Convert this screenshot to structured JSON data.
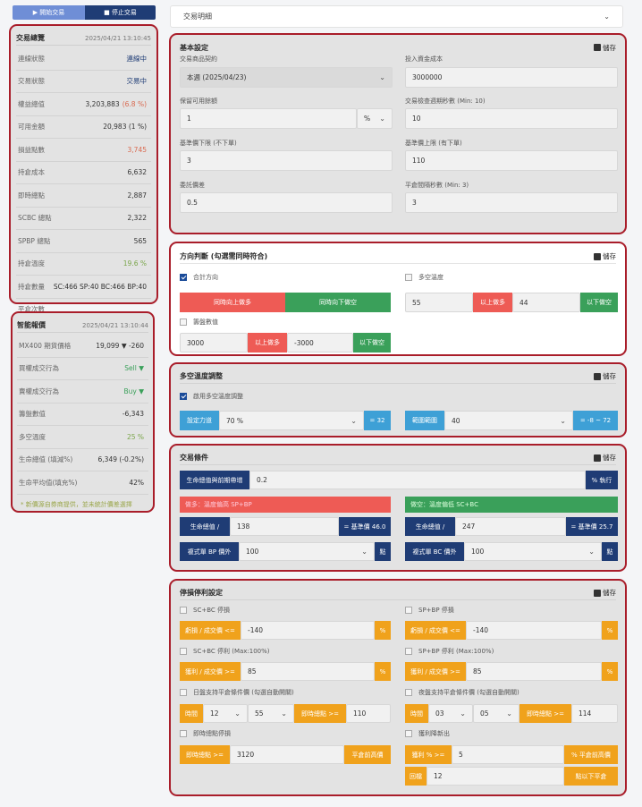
{
  "top_buttons": {
    "start": "▶ 開始交易",
    "stop": "■ 停止交易"
  },
  "overview": {
    "title": "交易總覽",
    "time": "2025/04/21 13:10:45",
    "rows": [
      {
        "label": "連線狀態",
        "value": "連線中"
      },
      {
        "label": "交易狀態",
        "value": "交易中"
      },
      {
        "label": "權益總值",
        "value": "3,203,883",
        "extra": "(6.8 %)"
      },
      {
        "label": "可用金額",
        "value": "20,983 (1 %)"
      },
      {
        "label": "損益點數",
        "value": "3,745"
      },
      {
        "label": "持倉成本",
        "value": "6,632"
      },
      {
        "label": "即時總點",
        "value": "2,887"
      },
      {
        "label": "SCBC 總點",
        "value": "2,322"
      },
      {
        "label": "SPBP 總點",
        "value": "565"
      },
      {
        "label": "持倉溫度",
        "value": "19.6 %"
      },
      {
        "label": "持倉數量",
        "value": "SC:466 SP:40 BC:466 BP:40"
      },
      {
        "label": "平倉次數",
        "value": ""
      }
    ]
  },
  "smart": {
    "title": "智能報價",
    "time": "2025/04/21 13:10:44",
    "rows": [
      {
        "label": "MX400 期貨價格",
        "value": "19,099 ▼ -260"
      },
      {
        "label": "買權成交行為",
        "value": "Sell ▼"
      },
      {
        "label": "賣權成交行為",
        "value": "Buy ▼"
      },
      {
        "label": "籌盤數值",
        "value": "-6,343"
      },
      {
        "label": "多空溫度",
        "value": "25 %"
      },
      {
        "label": "生命總值 (填減%)",
        "value": "6,349 (-0.2%)"
      },
      {
        "label": "生命平均值(填充%)",
        "value": "42%"
      }
    ],
    "note": "* 新價源自券商提供，並未統計價差選擇"
  },
  "detail_tab": "交易明細",
  "basic": {
    "title": "基本設定",
    "save": "儲存",
    "contract_label": "交易商品契約",
    "contract_value": "本週 (2025/04/23)",
    "capital_label": "投入資金成本",
    "capital_value": "3000000",
    "keep_label": "保留可用餘額",
    "keep_value": "1",
    "keep_unit": "%",
    "interval_label": "交易檢查週期秒數 (Min: 10)",
    "interval_value": "10",
    "lower_label": "基準價下限 (不下單)",
    "lower_value": "3",
    "upper_label": "基準價上限 (有下單)",
    "upper_value": "110",
    "commission_label": "委託價差",
    "commission_value": "0.5",
    "close_label": "平倉間隔秒數 (Min: 3)",
    "close_value": "3"
  },
  "direction": {
    "title": "方向判斷 (勾選需同時符合)",
    "save": "儲存",
    "combined_label": "合計方向",
    "up": "同時向上做多",
    "down": "同時向下做空",
    "temp_label": "多空溫度",
    "temp_low": "55",
    "temp_long": "以上做多",
    "temp_high": "44",
    "temp_short": "以下做空",
    "chip_label": "籌盤數值",
    "chip_low": "3000",
    "chip_long": "以上做多",
    "chip_high": "-3000",
    "chip_short": "以下做空"
  },
  "temp_adjust": {
    "title": "多空溫度調整",
    "save": "儲存",
    "enable": "啟用多空溫度調整",
    "power_label": "設定力道",
    "power_value": "70 %",
    "power_badge": "= 32",
    "range_label": "範圍範圍",
    "range_value": "40",
    "range_badge": "= -8 ~ 72"
  },
  "conditions": {
    "title": "交易條件",
    "save": "儲存",
    "life_label": "生命總值與前期帶增",
    "life_value": "0.2",
    "run": "% 執行",
    "long_header": "做多：溫度偏高 SP+BP",
    "short_header": "做空：溫度偏低 SC+BC",
    "life_l": "生命總值 /",
    "life_l_val": "138",
    "base_l": "= 基準價 46.0",
    "life_r": "生命總值 /",
    "life_r_val": "247",
    "base_r": "= 基準價 25.7",
    "bp_label": "複式單 BP 價外",
    "bp_val": "100",
    "bc_label": "複式單 BC 價外",
    "bc_val": "100",
    "pt": "點"
  },
  "stop": {
    "title": "停損停利設定",
    "save": "儲存",
    "sc_loss": "SC+BC 停損",
    "sp_loss": "SP+BP 停損",
    "loss_label": "虧損 / 成交價 <=",
    "loss_val": "-140",
    "pct": "%",
    "sc_profit": "SC+BC 停利 (Max:100%)",
    "sp_profit": "SP+BP 停利 (Max:100%)",
    "profit_label": "獲利 / 成交價 >=",
    "profit_val": "85",
    "day_label": "日盤支持平倉條件價 (勾選自動開關)",
    "night_label": "夜盤支持平倉條件價 (勾選自動開關)",
    "time_label": "時間",
    "h1": "12",
    "m1": "55",
    "h2": "03",
    "m2": "05",
    "instant": "即時總點 >=",
    "i1": "110",
    "i2": "114",
    "track_label": "即時總點停損",
    "track_val": "3120",
    "close_btn": "平倉前高價",
    "profit_exit": "獲利降新出",
    "ratio": "獲利 % >=",
    "ratio_val": "5",
    "pct_close": "% 平倉前高價",
    "back": "回檔",
    "back_val": "12",
    "back_btn": "點以下平倉"
  }
}
